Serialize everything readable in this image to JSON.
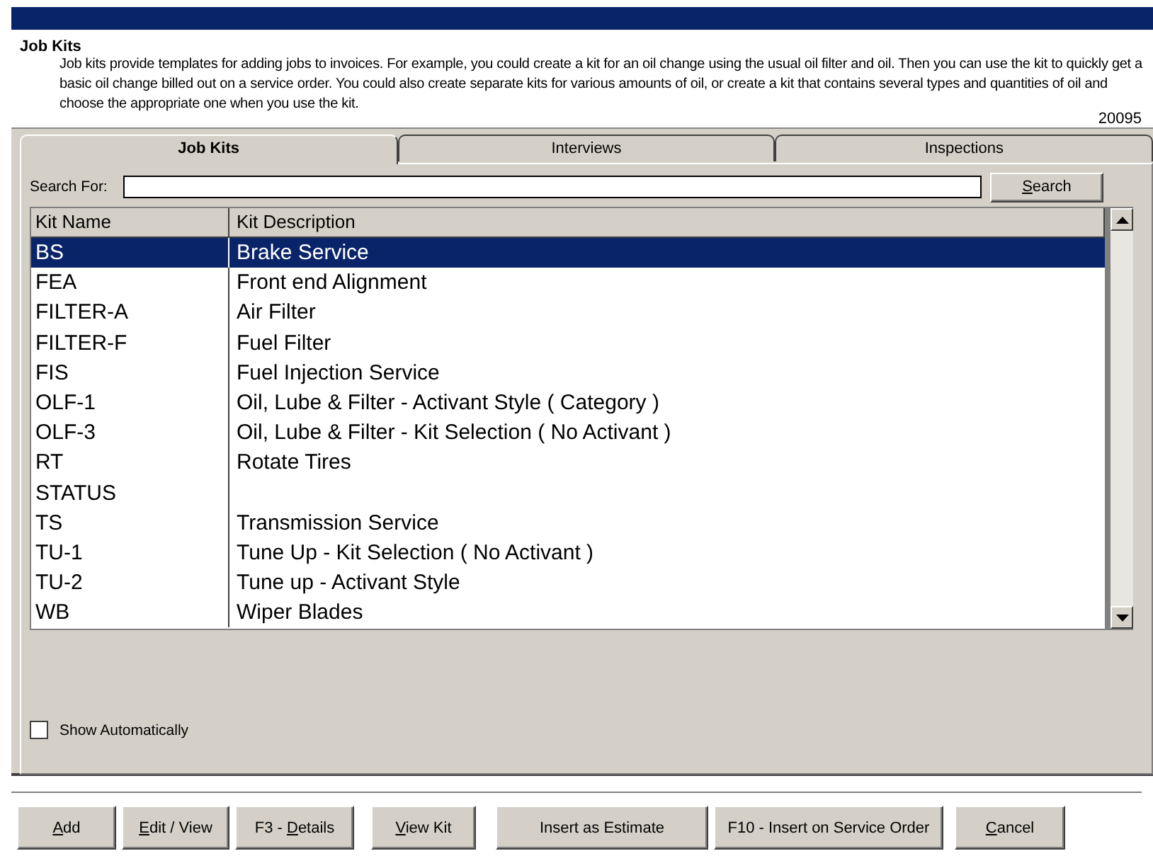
{
  "header": {
    "title": "Job Kits",
    "description": "Job kits provide templates for adding jobs to invoices.  For example, you could create a kit for an oil change using the usual oil filter and oil.  Then you can use the kit to quickly get a basic oil change billed out on a service order.  You could also create separate kits for various amounts of oil, or create a kit that contains several types and quantities of oil and choose the appropriate one when you use the kit.",
    "code": "20095"
  },
  "tabs": [
    {
      "label": "Job Kits",
      "selected": true
    },
    {
      "label": "Interviews",
      "selected": false
    },
    {
      "label": "Inspections",
      "selected": false
    }
  ],
  "search": {
    "label": "Search For:",
    "button": {
      "key": "S",
      "after": "earch"
    }
  },
  "table": {
    "columns": [
      "Kit Name",
      "Kit Description"
    ],
    "rows": [
      {
        "name": "BS",
        "description": "Brake Service",
        "selected": true
      },
      {
        "name": "FEA",
        "description": "Front end Alignment",
        "selected": false
      },
      {
        "name": "FILTER-A",
        "description": "Air Filter",
        "selected": false
      },
      {
        "name": "FILTER-F",
        "description": "Fuel Filter",
        "selected": false
      },
      {
        "name": "FIS",
        "description": "Fuel Injection Service",
        "selected": false
      },
      {
        "name": "OLF-1",
        "description": "Oil, Lube &  Filter - Activant Style ( Category )",
        "selected": false
      },
      {
        "name": "OLF-3",
        "description": "Oil, Lube &  Filter - Kit Selection ( No Activant )",
        "selected": false
      },
      {
        "name": "RT",
        "description": "Rotate Tires",
        "selected": false
      },
      {
        "name": "STATUS",
        "selected": false
      },
      {
        "name": "TS",
        "description": "Transmission Service",
        "selected": false
      },
      {
        "name": "TU-1",
        "description": "Tune Up - Kit Selection ( No Activant )",
        "selected": false
      },
      {
        "name": "TU-2",
        "description": "Tune up - Activant Style",
        "selected": false
      },
      {
        "name": "WB",
        "description": "Wiper Blades",
        "selected": false
      }
    ]
  },
  "show_automatically": {
    "label": "Show Automatically",
    "checked": false
  },
  "buttons": [
    {
      "key": "A",
      "after": "dd"
    },
    {
      "key": "E",
      "after": "dit / View"
    },
    {
      "before": "F3 - ",
      "key": "D",
      "after": "etails"
    },
    {
      "key": "V",
      "after": "iew Kit"
    },
    {
      "before": "Insert as Estimate"
    },
    {
      "before": "F10 - Insert on Service Order"
    },
    {
      "key": "C",
      "after": "ancel"
    }
  ]
}
